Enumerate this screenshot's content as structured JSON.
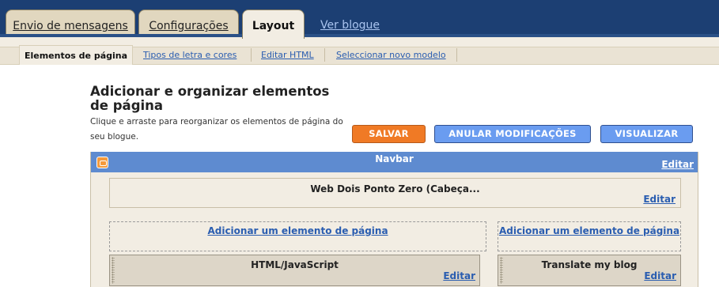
{
  "tabs": [
    {
      "label": "Envio de mensagens"
    },
    {
      "label": "Configurações"
    },
    {
      "label": "Layout"
    }
  ],
  "view_blog_link": "Ver blogue",
  "subnav": [
    {
      "label": "Elementos de página"
    },
    {
      "label": "Tipos de letra e cores"
    },
    {
      "label": "Editar HTML"
    },
    {
      "label": "Seleccionar novo modelo"
    }
  ],
  "page": {
    "title": "Adicionar e organizar elementos de página",
    "description": "Clique e arraste para reorganizar os elementos de página do seu blogue."
  },
  "buttons": {
    "save": "SALVAR",
    "cancel": "ANULAR MODIFICAÇÕES",
    "preview": "VISUALIZAR"
  },
  "layout": {
    "navbar": {
      "title": "Navbar",
      "edit": "Editar"
    },
    "header": {
      "title": "Web Dois Ponto Zero (Cabeça...",
      "edit": "Editar"
    },
    "add_main": "Adicionar um elemento de página",
    "add_sidebar": "Adicionar um elemento de página",
    "widgets": [
      {
        "title": "HTML/JavaScript",
        "edit": "Editar"
      },
      {
        "title": "Translate my blog",
        "edit": "Editar"
      }
    ]
  },
  "icons": {
    "blogger": "blogger-icon"
  },
  "colors": {
    "top_band": "#1c3f73",
    "save_button": "#f07a25",
    "blue_button": "#6a9cf0",
    "navbar": "#5e8bd0",
    "link": "#2a5db0"
  }
}
